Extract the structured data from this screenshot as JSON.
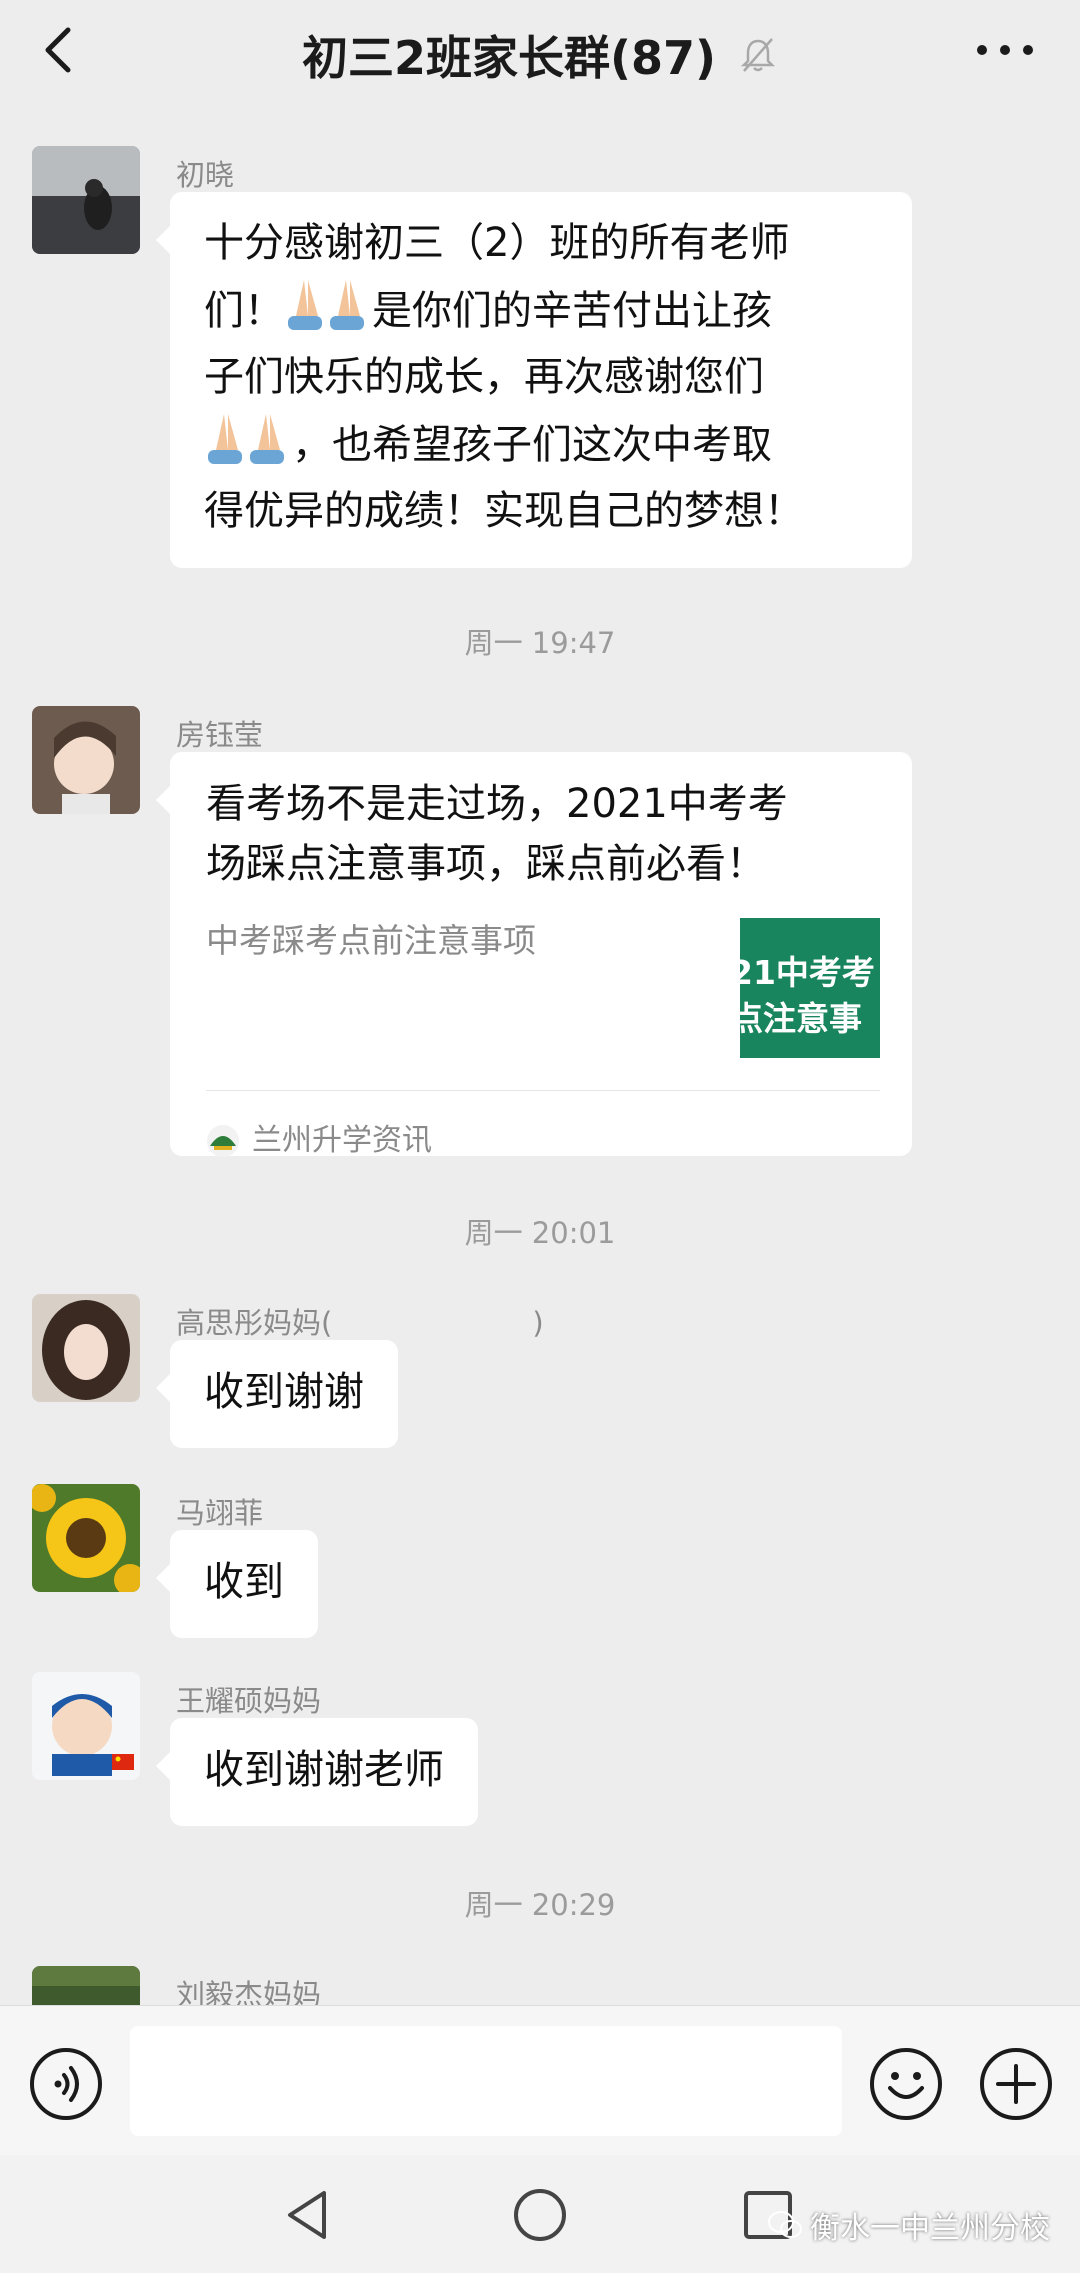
{
  "header": {
    "title": "初三2班家长群(87)",
    "back_icon": "chevron-left-icon",
    "mute_icon": "bell-muted-icon",
    "more_icon": "more-dots-icon"
  },
  "messages": [
    {
      "sender": "初晓",
      "text_parts": [
        "十分感谢初三（2）班的所有老师",
        "们！",
        "是你们的辛苦付出让孩",
        "子们快乐的成长，再次感谢您们",
        "，也希望孩子们这次中考取",
        "得优异的成绩！实现自己的梦想！"
      ]
    },
    {
      "time": "周一 19:47"
    },
    {
      "sender": "房钰莹",
      "card": {
        "title_line1": "看考场不是走过场，2021中考考",
        "title_line2": "场踩点注意事项，踩点前必看！",
        "description": "中考踩考点前注意事项",
        "thumb_line1": "21中考考",
        "thumb_line2": "点注意事",
        "source": "兰州升学资讯"
      }
    },
    {
      "time": "周一 20:01"
    },
    {
      "sender": "高思彤妈妈(",
      "sender_suffix": ")",
      "text": "收到谢谢"
    },
    {
      "sender": "马翊菲",
      "text": "收到"
    },
    {
      "sender": "王耀硕妈妈",
      "text": "收到谢谢老师"
    },
    {
      "time": "周一 20:29"
    },
    {
      "sender": "刘毅杰妈妈"
    }
  ],
  "input_bar": {
    "voice_icon": "voice-icon",
    "emoji_icon": "emoji-icon",
    "plus_icon": "plus-icon",
    "input_value": ""
  },
  "nav": {
    "back_icon": "nav-back-icon",
    "home_icon": "nav-home-icon",
    "recent_icon": "nav-recent-icon"
  },
  "watermark": "衡水一中兰州分校",
  "colors": {
    "background": "#ededed",
    "bubble": "#ffffff",
    "meta_text": "#8a8a8a",
    "card_thumb": "#19855f"
  }
}
